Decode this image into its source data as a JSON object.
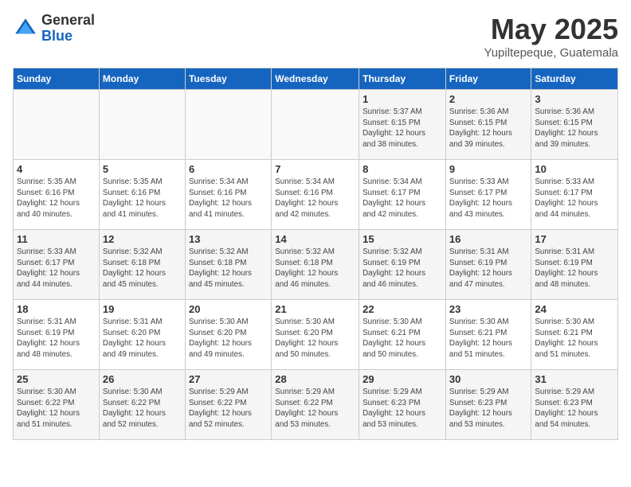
{
  "header": {
    "logo_general": "General",
    "logo_blue": "Blue",
    "month_title": "May 2025",
    "location": "Yupiltepeque, Guatemala"
  },
  "days_of_week": [
    "Sunday",
    "Monday",
    "Tuesday",
    "Wednesday",
    "Thursday",
    "Friday",
    "Saturday"
  ],
  "weeks": [
    [
      {
        "day": "",
        "info": ""
      },
      {
        "day": "",
        "info": ""
      },
      {
        "day": "",
        "info": ""
      },
      {
        "day": "",
        "info": ""
      },
      {
        "day": "1",
        "info": "Sunrise: 5:37 AM\nSunset: 6:15 PM\nDaylight: 12 hours\nand 38 minutes."
      },
      {
        "day": "2",
        "info": "Sunrise: 5:36 AM\nSunset: 6:15 PM\nDaylight: 12 hours\nand 39 minutes."
      },
      {
        "day": "3",
        "info": "Sunrise: 5:36 AM\nSunset: 6:15 PM\nDaylight: 12 hours\nand 39 minutes."
      }
    ],
    [
      {
        "day": "4",
        "info": "Sunrise: 5:35 AM\nSunset: 6:16 PM\nDaylight: 12 hours\nand 40 minutes."
      },
      {
        "day": "5",
        "info": "Sunrise: 5:35 AM\nSunset: 6:16 PM\nDaylight: 12 hours\nand 41 minutes."
      },
      {
        "day": "6",
        "info": "Sunrise: 5:34 AM\nSunset: 6:16 PM\nDaylight: 12 hours\nand 41 minutes."
      },
      {
        "day": "7",
        "info": "Sunrise: 5:34 AM\nSunset: 6:16 PM\nDaylight: 12 hours\nand 42 minutes."
      },
      {
        "day": "8",
        "info": "Sunrise: 5:34 AM\nSunset: 6:17 PM\nDaylight: 12 hours\nand 42 minutes."
      },
      {
        "day": "9",
        "info": "Sunrise: 5:33 AM\nSunset: 6:17 PM\nDaylight: 12 hours\nand 43 minutes."
      },
      {
        "day": "10",
        "info": "Sunrise: 5:33 AM\nSunset: 6:17 PM\nDaylight: 12 hours\nand 44 minutes."
      }
    ],
    [
      {
        "day": "11",
        "info": "Sunrise: 5:33 AM\nSunset: 6:17 PM\nDaylight: 12 hours\nand 44 minutes."
      },
      {
        "day": "12",
        "info": "Sunrise: 5:32 AM\nSunset: 6:18 PM\nDaylight: 12 hours\nand 45 minutes."
      },
      {
        "day": "13",
        "info": "Sunrise: 5:32 AM\nSunset: 6:18 PM\nDaylight: 12 hours\nand 45 minutes."
      },
      {
        "day": "14",
        "info": "Sunrise: 5:32 AM\nSunset: 6:18 PM\nDaylight: 12 hours\nand 46 minutes."
      },
      {
        "day": "15",
        "info": "Sunrise: 5:32 AM\nSunset: 6:19 PM\nDaylight: 12 hours\nand 46 minutes."
      },
      {
        "day": "16",
        "info": "Sunrise: 5:31 AM\nSunset: 6:19 PM\nDaylight: 12 hours\nand 47 minutes."
      },
      {
        "day": "17",
        "info": "Sunrise: 5:31 AM\nSunset: 6:19 PM\nDaylight: 12 hours\nand 48 minutes."
      }
    ],
    [
      {
        "day": "18",
        "info": "Sunrise: 5:31 AM\nSunset: 6:19 PM\nDaylight: 12 hours\nand 48 minutes."
      },
      {
        "day": "19",
        "info": "Sunrise: 5:31 AM\nSunset: 6:20 PM\nDaylight: 12 hours\nand 49 minutes."
      },
      {
        "day": "20",
        "info": "Sunrise: 5:30 AM\nSunset: 6:20 PM\nDaylight: 12 hours\nand 49 minutes."
      },
      {
        "day": "21",
        "info": "Sunrise: 5:30 AM\nSunset: 6:20 PM\nDaylight: 12 hours\nand 50 minutes."
      },
      {
        "day": "22",
        "info": "Sunrise: 5:30 AM\nSunset: 6:21 PM\nDaylight: 12 hours\nand 50 minutes."
      },
      {
        "day": "23",
        "info": "Sunrise: 5:30 AM\nSunset: 6:21 PM\nDaylight: 12 hours\nand 51 minutes."
      },
      {
        "day": "24",
        "info": "Sunrise: 5:30 AM\nSunset: 6:21 PM\nDaylight: 12 hours\nand 51 minutes."
      }
    ],
    [
      {
        "day": "25",
        "info": "Sunrise: 5:30 AM\nSunset: 6:22 PM\nDaylight: 12 hours\nand 51 minutes."
      },
      {
        "day": "26",
        "info": "Sunrise: 5:30 AM\nSunset: 6:22 PM\nDaylight: 12 hours\nand 52 minutes."
      },
      {
        "day": "27",
        "info": "Sunrise: 5:29 AM\nSunset: 6:22 PM\nDaylight: 12 hours\nand 52 minutes."
      },
      {
        "day": "28",
        "info": "Sunrise: 5:29 AM\nSunset: 6:22 PM\nDaylight: 12 hours\nand 53 minutes."
      },
      {
        "day": "29",
        "info": "Sunrise: 5:29 AM\nSunset: 6:23 PM\nDaylight: 12 hours\nand 53 minutes."
      },
      {
        "day": "30",
        "info": "Sunrise: 5:29 AM\nSunset: 6:23 PM\nDaylight: 12 hours\nand 53 minutes."
      },
      {
        "day": "31",
        "info": "Sunrise: 5:29 AM\nSunset: 6:23 PM\nDaylight: 12 hours\nand 54 minutes."
      }
    ]
  ]
}
